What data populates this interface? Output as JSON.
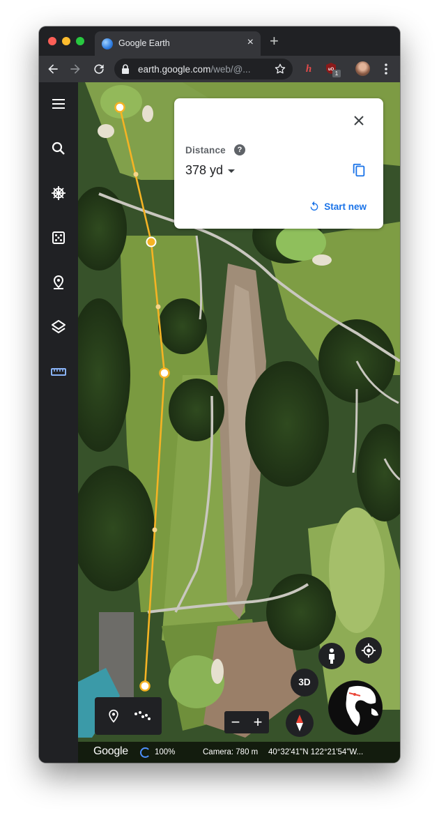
{
  "browser": {
    "tab_title": "Google Earth",
    "tab_close": "×",
    "new_tab": "+",
    "url_host": "earth.google.com",
    "url_path": "/web/@...",
    "extension_badge": "1"
  },
  "sidebar": {
    "items": [
      {
        "name": "menu",
        "icon": "menu-icon"
      },
      {
        "name": "search",
        "icon": "search-icon"
      },
      {
        "name": "voyager",
        "icon": "voyager-wheel-icon"
      },
      {
        "name": "feeling-lucky",
        "icon": "dice-icon"
      },
      {
        "name": "projects",
        "icon": "map-pin-icon"
      },
      {
        "name": "map-style",
        "icon": "layers-icon"
      },
      {
        "name": "measure",
        "icon": "ruler-icon",
        "active": true
      }
    ]
  },
  "distance_card": {
    "label": "Distance",
    "help": "?",
    "value": "378 yd",
    "start_new": "Start new"
  },
  "map_controls": {
    "zoom_out": "−",
    "zoom_in": "+",
    "view_3d": "3D"
  },
  "status": {
    "logo": "Google",
    "load_percent": "100%",
    "camera": "Camera: 780 m",
    "coordinates": "40°32'41\"N 122°21'54\"W..."
  },
  "colors": {
    "measure_line": "#f5b324",
    "accent_blue": "#1a73e8",
    "dark_ui": "#202124"
  }
}
